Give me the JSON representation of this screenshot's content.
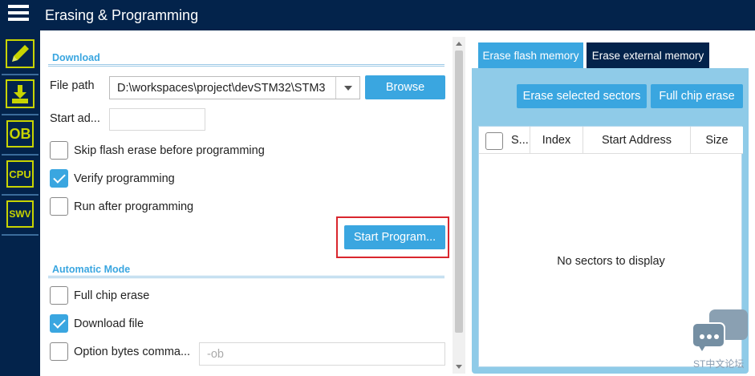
{
  "window": {
    "title": "Erasing & Programming"
  },
  "sidebar": {
    "items": [
      {
        "name": "edit"
      },
      {
        "name": "download"
      },
      {
        "name": "OB",
        "label": "OB"
      },
      {
        "name": "CPU",
        "label": "CPU"
      },
      {
        "name": "SWV",
        "label": "SWV"
      }
    ]
  },
  "download": {
    "section_title": "Download",
    "file_path_label": "File path",
    "file_path_value": "D:\\workspaces\\project\\devSTM32\\STM3",
    "browse_label": "Browse",
    "start_address_label": "Start ad...",
    "start_address_value": "",
    "options": [
      {
        "label": "Skip flash erase before programming",
        "checked": false
      },
      {
        "label": "Verify programming",
        "checked": true
      },
      {
        "label": "Run after programming",
        "checked": false
      }
    ],
    "start_button_label": "Start Program..."
  },
  "automatic": {
    "section_title": "Automatic Mode",
    "options": [
      {
        "label": "Full chip erase",
        "checked": false
      },
      {
        "label": "Download file",
        "checked": true
      },
      {
        "label": "Option bytes comma...",
        "checked": false
      }
    ],
    "option_bytes_placeholder": "-ob"
  },
  "erase": {
    "tabs": [
      {
        "label": "Erase flash memory",
        "active": true
      },
      {
        "label": "Erase external memory",
        "active": false
      }
    ],
    "erase_selected_label": "Erase selected sectors",
    "full_chip_erase_label": "Full chip erase",
    "table_headers": [
      "S...",
      "Index",
      "Start Address",
      "Size"
    ],
    "empty_message": "No sectors to display"
  },
  "watermark": "ST中文论坛",
  "colors": {
    "navy": "#03234b",
    "accent": "#3aa6e0",
    "highlight": "#d9262e",
    "icon": "#c8d400"
  }
}
